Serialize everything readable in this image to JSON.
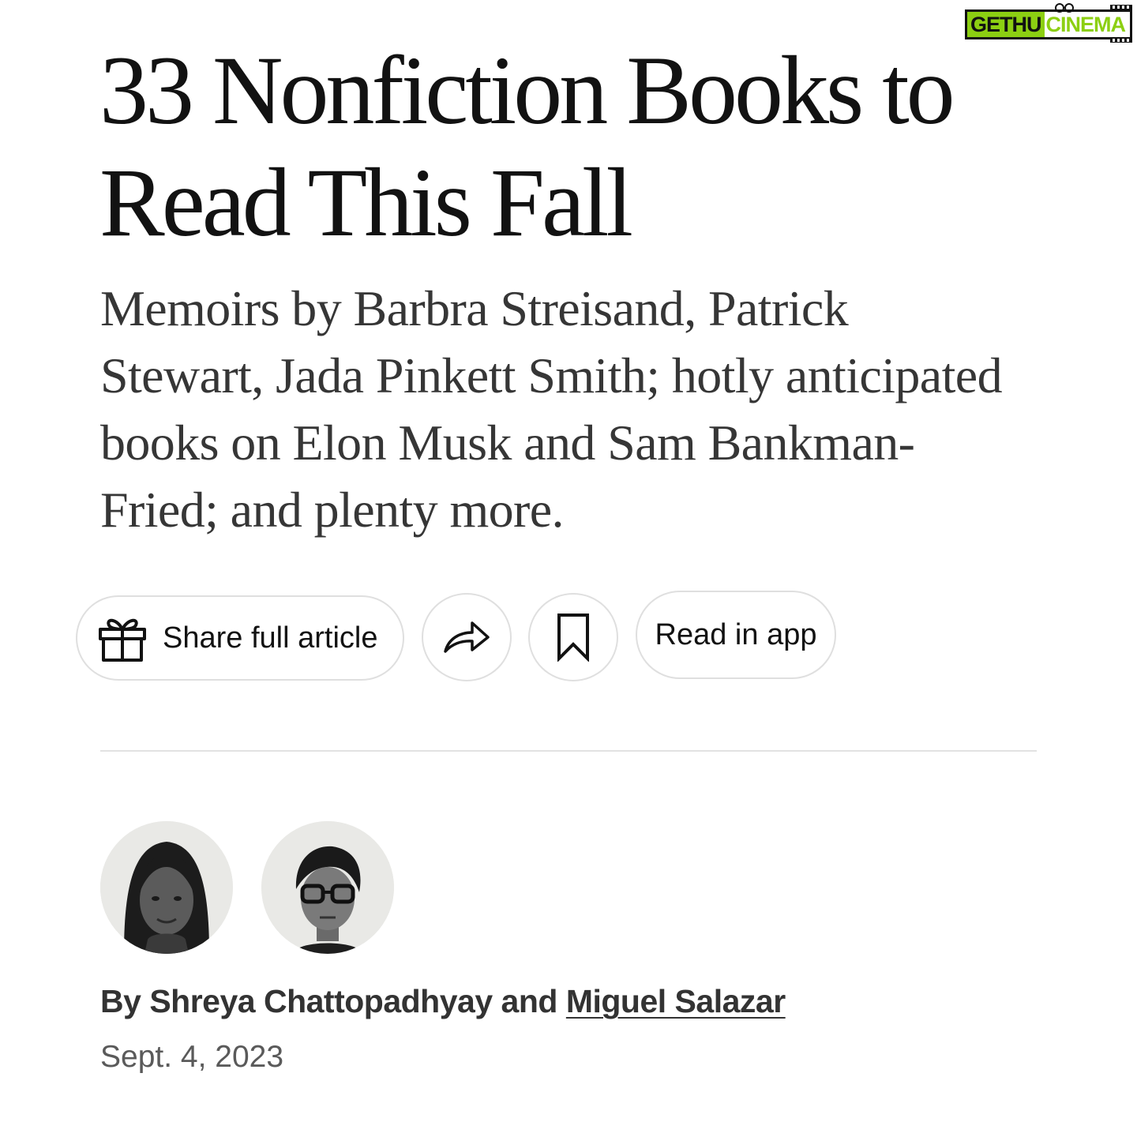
{
  "article": {
    "headline": "33 Nonfiction Books to Read This Fall",
    "summary": "Memoirs by Barbra Streisand, Patrick Stewart, Jada Pinkett Smith; hotly anticipated books on Elon Musk and Sam Bankman-Fried; and plenty more."
  },
  "actions": {
    "share_full_article": {
      "label": "Share full article",
      "icon": "gift-icon"
    },
    "share": {
      "icon": "share-arrow-icon"
    },
    "save": {
      "icon": "bookmark-icon"
    },
    "read_in_app": {
      "label": "Read in app"
    }
  },
  "byline": {
    "prefix": "By",
    "author_1": "Shreya Chattopadhyay",
    "conjunction": "and",
    "author_2": "Miguel Salazar",
    "date": "Sept. 4, 2023"
  },
  "watermark": {
    "part_1": "GETHU",
    "part_2": "CINEMA",
    "accent_color": "#8ccf12"
  },
  "colors": {
    "text": "#121212",
    "summary": "#363636",
    "byline": "#333333",
    "date": "#5a5a5a",
    "border": "#dfdfdf",
    "divider": "#e2e2e2"
  }
}
